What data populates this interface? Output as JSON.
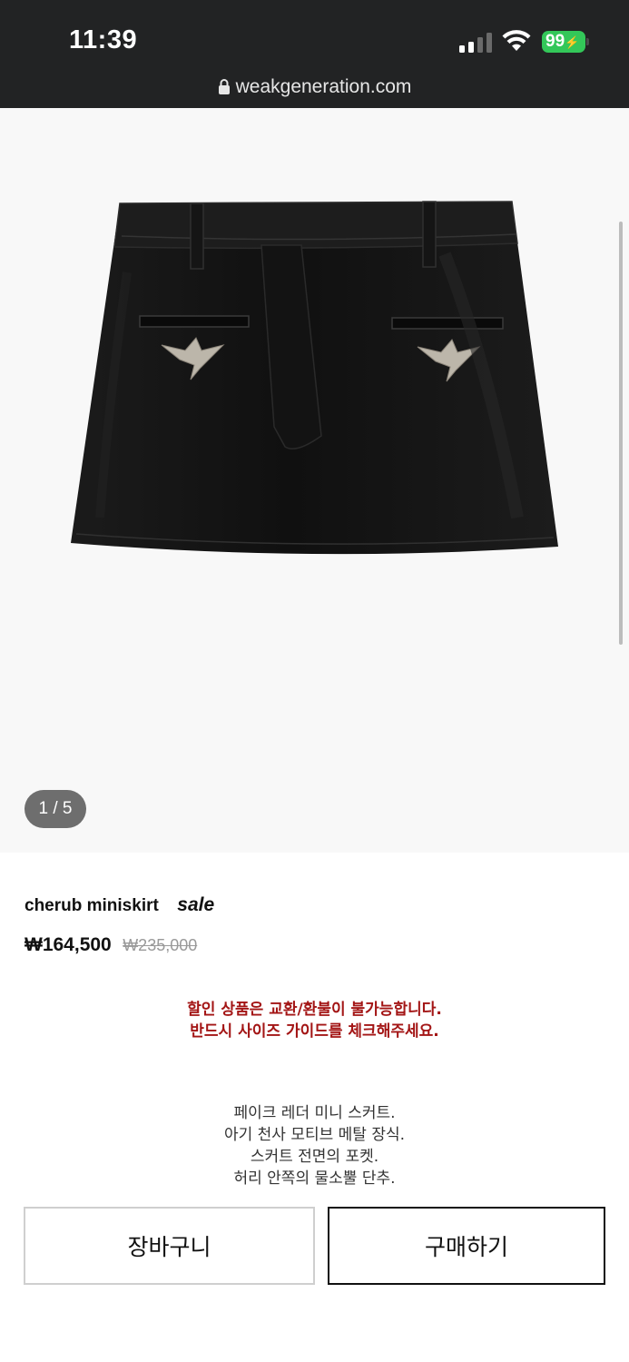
{
  "status_bar": {
    "time": "11:39",
    "battery": "99"
  },
  "browser": {
    "url": "weakgeneration.com"
  },
  "gallery": {
    "counter": "1 / 5"
  },
  "product": {
    "name": "cherub miniskirt",
    "badge": "sale",
    "price": "₩164,500",
    "original_price": "₩235,000"
  },
  "notice": {
    "line1": "할인 상품은 교환/환불이 불가능합니다.",
    "line2": "반드시 사이즈 가이드를 체크해주세요."
  },
  "description": {
    "lines": [
      "페이크 레더 미니 스커트.",
      "아기 천사 모티브 메탈 장식.",
      "스커트 전면의 포켓.",
      "허리 안쪽의 물소뿔 단추."
    ]
  },
  "actions": {
    "cart_label": "장바구니",
    "buy_label": "구매하기"
  },
  "colors": {
    "notice": "#a31515",
    "battery": "#33c759",
    "topbar": "#222324"
  }
}
